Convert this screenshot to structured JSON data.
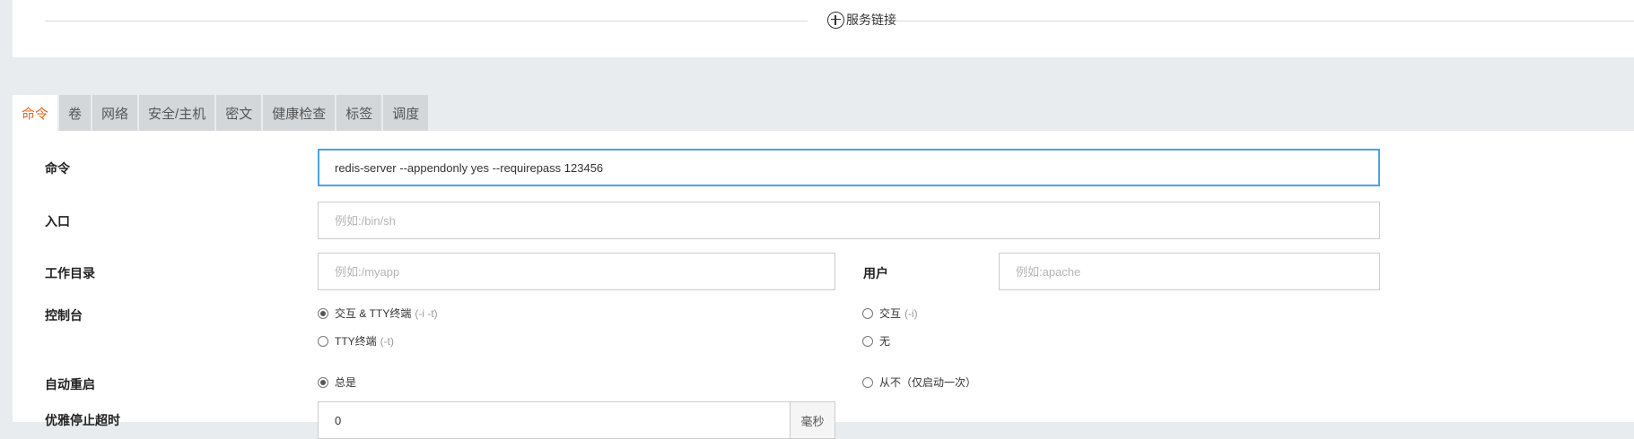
{
  "top": {
    "service_link_label": "服务链接"
  },
  "tabs": [
    "命令",
    "卷",
    "网络",
    "安全/主机",
    "密文",
    "健康检查",
    "标签",
    "调度"
  ],
  "form": {
    "command": {
      "label": "命令",
      "value": "redis-server --appendonly yes --requirepass 123456"
    },
    "entrypoint": {
      "label": "入口",
      "placeholder": "例如:/bin/sh"
    },
    "workdir": {
      "label": "工作目录",
      "placeholder": "例如:/myapp"
    },
    "user": {
      "label": "用户",
      "placeholder": "例如:apache"
    },
    "console": {
      "label": "控制台",
      "options": [
        {
          "text": "交互 & TTY终端",
          "hint": "(-i -t)",
          "checked": true
        },
        {
          "text": "交互",
          "hint": "(-i)",
          "checked": false
        },
        {
          "text": "TTY终端",
          "hint": "(-t)",
          "checked": false
        },
        {
          "text": "无",
          "hint": "",
          "checked": false
        }
      ]
    },
    "restart": {
      "label": "自动重启",
      "options": [
        {
          "text": "总是",
          "checked": true
        },
        {
          "text": "从不（仅启动一次）",
          "checked": false
        }
      ]
    },
    "stop_timeout": {
      "label": "优雅停止超时",
      "value": "0",
      "unit": "毫秒"
    }
  }
}
